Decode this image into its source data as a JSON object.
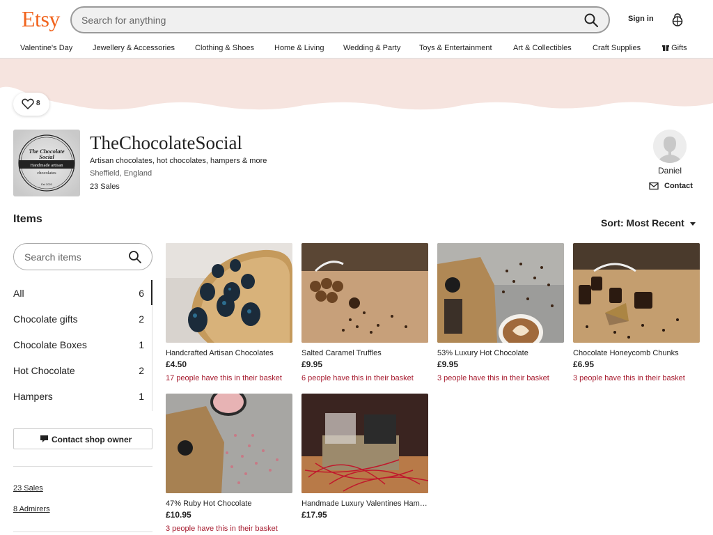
{
  "header": {
    "logo": "Etsy",
    "search_placeholder": "Search for anything",
    "sign_in": "Sign in"
  },
  "categories": [
    "Valentine's Day",
    "Jewellery & Accessories",
    "Clothing & Shoes",
    "Home & Living",
    "Wedding & Party",
    "Toys & Entertainment",
    "Art & Collectibles",
    "Craft Supplies",
    "Gifts"
  ],
  "favorite_count": "8",
  "shop": {
    "name": "TheChocolateSocial",
    "tagline": "Artisan chocolates, hot chocolates, hampers & more",
    "location": "Sheffield, England",
    "sales": "23 Sales",
    "logo_text": [
      "The Chocolate Social",
      "Handmade artisan chocolates",
      "Est 2020"
    ]
  },
  "owner": {
    "name": "Daniel",
    "contact_label": "Contact"
  },
  "items_heading": "Items",
  "sort_label": "Sort: Most Recent",
  "item_search_placeholder": "Search items",
  "sections": [
    {
      "label": "All",
      "count": "6"
    },
    {
      "label": "Chocolate gifts",
      "count": "2"
    },
    {
      "label": "Chocolate Boxes",
      "count": "1"
    },
    {
      "label": "Hot Chocolate",
      "count": "2"
    },
    {
      "label": "Hampers",
      "count": "1"
    }
  ],
  "contact_owner_label": "Contact shop owner",
  "sidebar_links": {
    "sales": "23 Sales",
    "admirers": "8 Admirers"
  },
  "listings": [
    {
      "title": "Handcrafted Artisan Chocolates",
      "price": "£4.50",
      "basket": "17 people have this in their basket"
    },
    {
      "title": "Salted Caramel Truffles",
      "price": "£9.95",
      "basket": "6 people have this in their basket"
    },
    {
      "title": "53% Luxury Hot Chocolate",
      "price": "£9.95",
      "basket": "3 people have this in their basket"
    },
    {
      "title": "Chocolate Honeycomb Chunks",
      "price": "£6.95",
      "basket": "3 people have this in their basket"
    },
    {
      "title": "47% Ruby Hot Chocolate",
      "price": "£10.95",
      "basket": "3 people have this in their basket"
    },
    {
      "title": "Handmade Luxury Valentines Hamper",
      "price": "£17.95",
      "basket": ""
    }
  ],
  "colors": {
    "brand": "#f1641e",
    "banner": "#f6e4df",
    "basket_note": "#a61a2e"
  }
}
